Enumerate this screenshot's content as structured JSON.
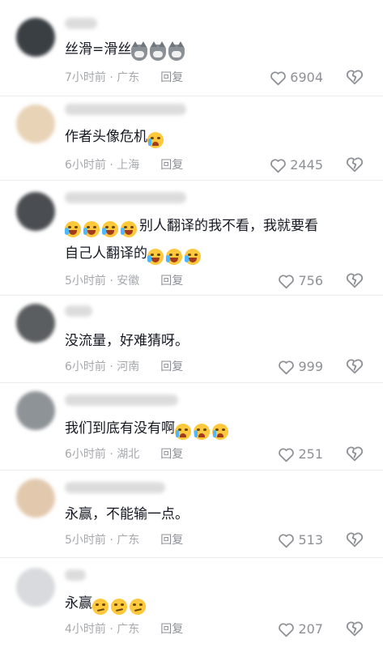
{
  "comments": [
    {
      "text": "丝滑=滑丝",
      "emojis": [
        "wolf",
        "wolf",
        "wolf"
      ],
      "time": "7小时前",
      "location": "广东",
      "reply_label": "回复",
      "likes": "6904",
      "avatar_color": "#3a3f44"
    },
    {
      "text": "作者头像危机",
      "emojis": [
        "cry"
      ],
      "time": "6小时前",
      "location": "上海",
      "reply_label": "回复",
      "likes": "2445",
      "avatar_color": "#e8d3b7"
    },
    {
      "text_prefix_emojis": [
        "laughcry",
        "laughcry",
        "laughcry",
        "laughcry"
      ],
      "text": "别人翻译的我不看，我就要看",
      "text_line2": "自己人翻译的",
      "emojis": [
        "laughcry",
        "laughcry",
        "laughcry"
      ],
      "time": "5小时前",
      "location": "安徽",
      "reply_label": "回复",
      "likes": "756",
      "avatar_color": "#4a4d52"
    },
    {
      "text": "没流量，好难猜呀。",
      "emojis": [],
      "time": "6小时前",
      "location": "河南",
      "reply_label": "回复",
      "likes": "999",
      "avatar_color": "#5b5e60"
    },
    {
      "text": "我们到底有没有啊",
      "emojis": [
        "cry",
        "cry",
        "cry"
      ],
      "time": "6小时前",
      "location": "湖北",
      "reply_label": "回复",
      "likes": "251",
      "avatar_color": "#8e9398"
    },
    {
      "text": "永赢，不能输一点。",
      "emojis": [],
      "time": "5小时前",
      "location": "广东",
      "reply_label": "回复",
      "likes": "513",
      "avatar_color": "#e2c9ae"
    },
    {
      "text": "永赢",
      "emojis": [
        "smirk",
        "smirk",
        "smirk"
      ],
      "time": "4小时前",
      "location": "广东",
      "reply_label": "回复",
      "likes": "207",
      "avatar_color": "#d8dadd"
    }
  ],
  "meta_separator": " · ",
  "colors": {
    "text": "#161823",
    "meta": "#a6a8ac",
    "icon": "#8e9096"
  }
}
